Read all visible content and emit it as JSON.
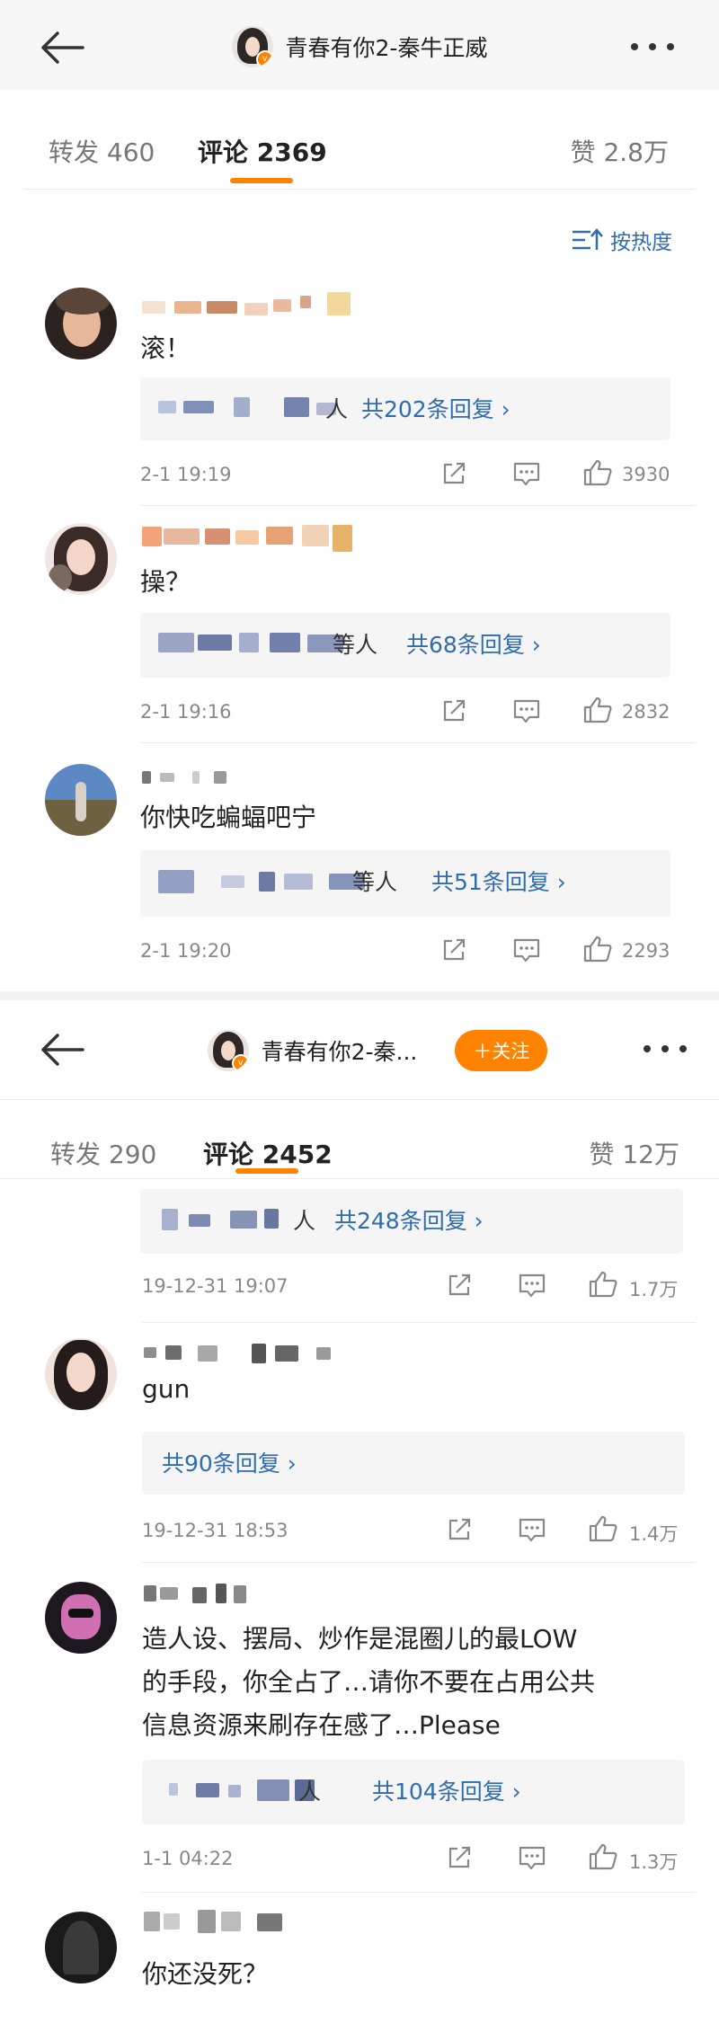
{
  "panel1": {
    "title": "青春有你2-秦牛正威",
    "tabs": {
      "repost": "转发 460",
      "comments": "评论 2369",
      "likes": "赞 2.8万"
    },
    "sort": "按热度",
    "comments": [
      {
        "text": "滚！",
        "reply_label": "人",
        "reply_count": "共202条回复 ›",
        "time": "2-1 19:19",
        "likes": "3930"
      },
      {
        "text": "操？",
        "reply_label": "等人",
        "reply_count": "共68条回复 ›",
        "time": "2-1 19:16",
        "likes": "2832"
      },
      {
        "text": "你快吃蝙蝠吧宁",
        "reply_label": "等人",
        "reply_count": "共51条回复 ›",
        "time": "2-1 19:20",
        "likes": "2293"
      }
    ]
  },
  "panel2": {
    "title": "青春有你2-秦...",
    "follow": "＋关注",
    "tabs": {
      "repost": "转发 290",
      "comments": "评论 2452",
      "likes": "赞 12万"
    },
    "top_reply": {
      "reply_label": "人",
      "reply_count": "共248条回复 ›",
      "time": "19-12-31 19:07",
      "likes": "1.7万"
    },
    "comments": [
      {
        "text": "gun",
        "reply_count": "共90条回复 ›",
        "time": "19-12-31 18:53",
        "likes": "1.4万"
      },
      {
        "text_line1": "造人设、摆局、炒作是混圈儿的最LOW",
        "text_line2": "的手段，你全占了…请你不要在占用公共",
        "text_line3": "信息资源来刷存在感了…Please",
        "reply_label": "人",
        "reply_count": "共104条回复 ›",
        "time": "1-1 04:22",
        "likes": "1.3万"
      },
      {
        "text": "你还没死？"
      }
    ]
  },
  "colors": {
    "accent": "#ff8200",
    "link": "#2f6cb0",
    "muted": "#888888"
  }
}
